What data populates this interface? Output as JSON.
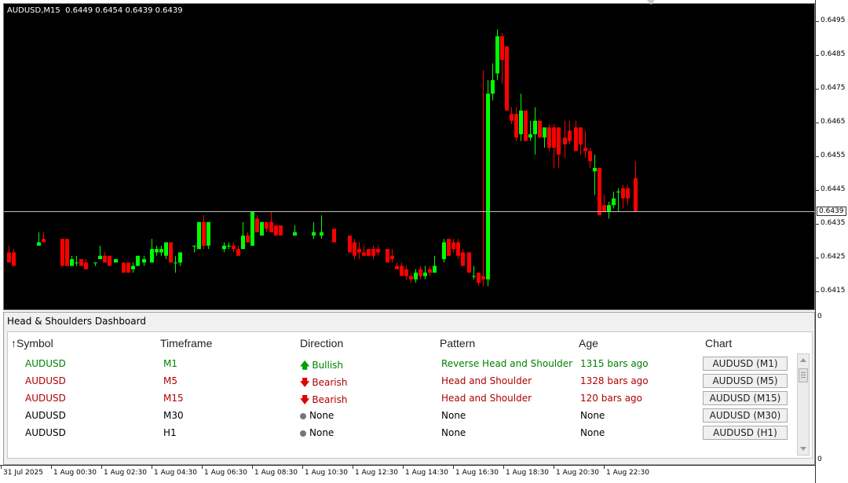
{
  "chart": {
    "symbol_label": "AUDUSD,M15",
    "ohlc_label": "0.6449 0.6454 0.6439 0.6439",
    "current_price": "0.6439",
    "price_ticks": [
      "0.6495",
      "0.6485",
      "0.6475",
      "0.6465",
      "0.6455",
      "0.6445",
      "0.6435",
      "0.6425",
      "0.6415"
    ],
    "subwindow_scale_top": "0",
    "subwindow_scale_bottom": "0",
    "time_ticks": [
      "31 Jul 2025",
      "1 Aug 00:30",
      "1 Aug 02:30",
      "1 Aug 04:30",
      "1 Aug 06:30",
      "1 Aug 08:30",
      "1 Aug 10:30",
      "1 Aug 12:30",
      "1 Aug 14:30",
      "1 Aug 16:30",
      "1 Aug 18:30",
      "1 Aug 20:30",
      "1 Aug 22:30"
    ],
    "colors": {
      "bull": "#00ff00",
      "bear": "#ff0000",
      "background": "#000000",
      "price_line": "#c0c0c0"
    }
  },
  "dashboard": {
    "title": "Head & Shoulders Dashboard",
    "headers": {
      "symbol": "Symbol",
      "timeframe": "Timeframe",
      "direction": "Direction",
      "pattern": "Pattern",
      "age": "Age",
      "chart": "Chart"
    },
    "sort_icon": "sort-up-arrow-icon",
    "rows": [
      {
        "symbol": "AUDUSD",
        "timeframe": "M1",
        "direction": "Bullish",
        "direction_icon": "arrow-up-icon",
        "pattern": "Reverse Head and Shoulder",
        "age": "1315 bars ago",
        "button": "AUDUSD (M1)",
        "color": "#008000"
      },
      {
        "symbol": "AUDUSD",
        "timeframe": "M5",
        "direction": "Bearish",
        "direction_icon": "arrow-down-icon",
        "pattern": "Head and Shoulder",
        "age": "1328 bars ago",
        "button": "AUDUSD (M5)",
        "color": "#b00000"
      },
      {
        "symbol": "AUDUSD",
        "timeframe": "M15",
        "direction": "Bearish",
        "direction_icon": "arrow-down-icon",
        "pattern": "Head and Shoulder",
        "age": "120 bars ago",
        "button": "AUDUSD (M15)",
        "color": "#b00000"
      },
      {
        "symbol": "AUDUSD",
        "timeframe": "M30",
        "direction": "None",
        "direction_icon": "dot-icon",
        "pattern": "None",
        "age": "None",
        "button": "AUDUSD (M30)",
        "color": "#000000"
      },
      {
        "symbol": "AUDUSD",
        "timeframe": "H1",
        "direction": "None",
        "direction_icon": "dot-icon",
        "pattern": "None",
        "age": "None",
        "button": "AUDUSD (H1)",
        "color": "#000000"
      }
    ]
  }
}
